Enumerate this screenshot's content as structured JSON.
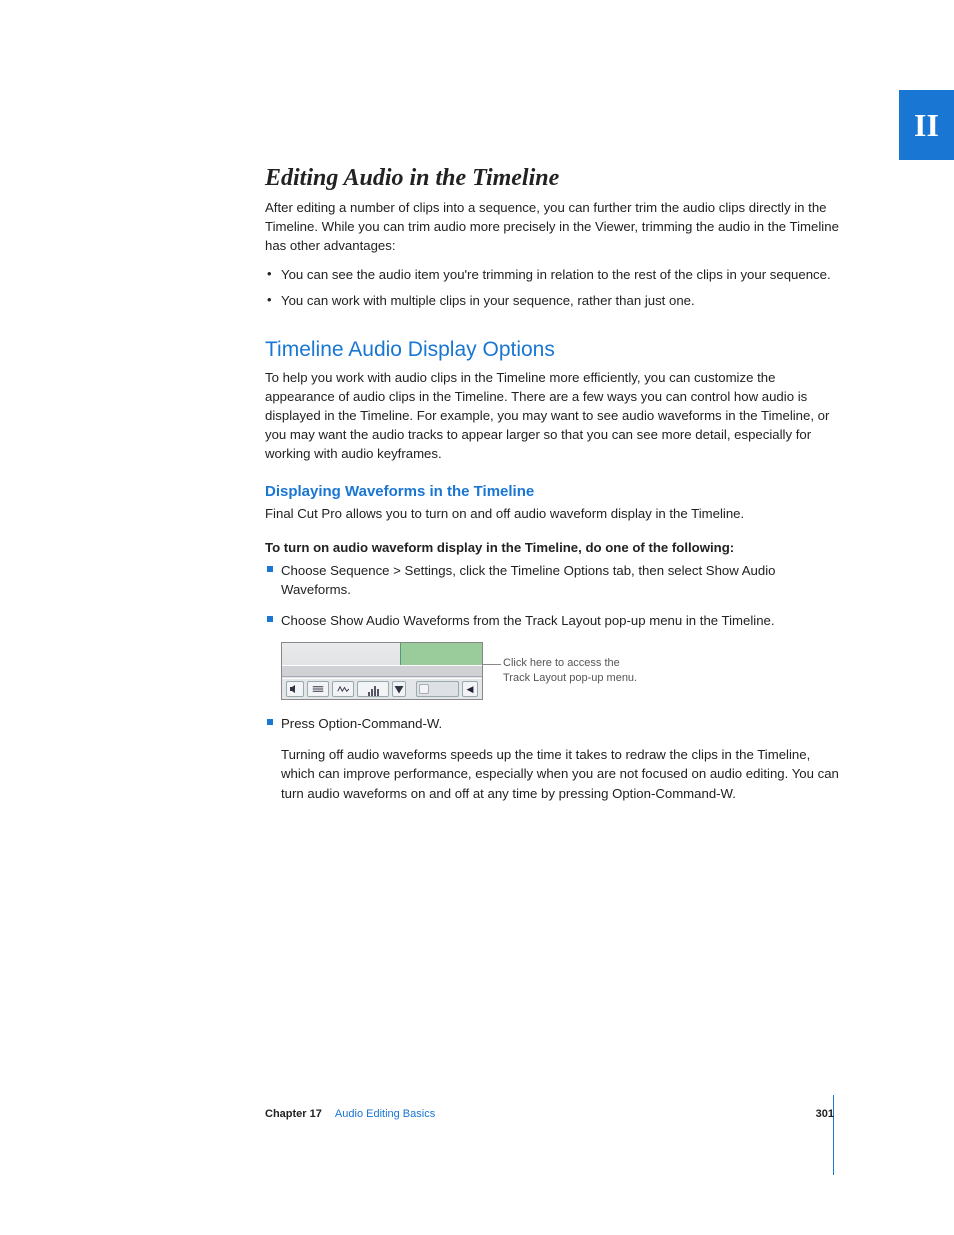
{
  "section_tab": "II",
  "h1": "Editing Audio in the Timeline",
  "intro": "After editing a number of clips into a sequence, you can further trim the audio clips directly in the Timeline. While you can trim audio more precisely in the Viewer, trimming the audio in the Timeline has other advantages:",
  "intro_bullets": [
    "You can see the audio item you're trimming in relation to the rest of the clips in your sequence.",
    "You can work with multiple clips in your sequence, rather than just one."
  ],
  "h2": "Timeline Audio Display Options",
  "h2_body": "To help you work with audio clips in the Timeline more efficiently, you can customize the appearance of audio clips in the Timeline. There are a few ways you can control how audio is displayed in the Timeline. For example, you may want to see audio waveforms in the Timeline, or you may want the audio tracks to appear larger so that you can see more detail, especially for working with audio keyframes.",
  "h3": "Displaying Waveforms in the Timeline",
  "h3_body": "Final Cut Pro allows you to turn on and off audio waveform display in the Timeline.",
  "steps_lead": "To turn on audio waveform display in the Timeline, do one of the following:",
  "steps": [
    "Choose Sequence > Settings, click the Timeline Options tab, then select Show Audio Waveforms.",
    "Choose Show Audio Waveforms from the Track Layout pop-up menu in the Timeline."
  ],
  "callout": "Click here to access the Track Layout pop-up menu.",
  "step3": "Press Option-Command-W.",
  "closing": "Turning off audio waveforms speeds up the time it takes to redraw the clips in the Timeline, which can improve performance, especially when you are not focused on audio editing. You can turn audio waveforms on and off at any time by pressing Option-Command-W.",
  "footer": {
    "chapter_label": "Chapter 17",
    "chapter_title": "Audio Editing Basics",
    "page": "301"
  }
}
